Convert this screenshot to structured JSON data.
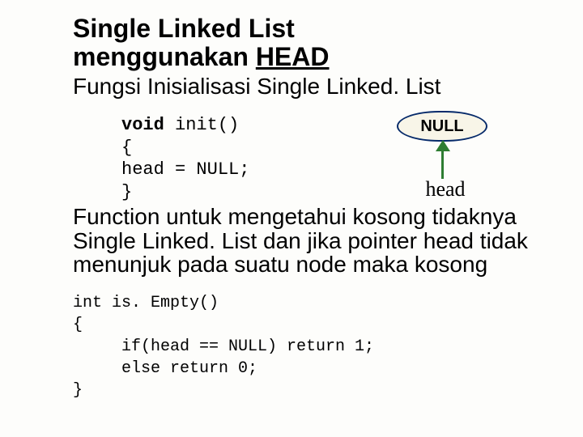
{
  "title": {
    "line1": "Single Linked List",
    "line2_text": "menggunakan ",
    "line2_ul": "HEAD"
  },
  "subtitle": "Fungsi Inisialisasi Single Linked. List",
  "code1": {
    "kw": "void",
    "rest": " init()\n{\nhead = NULL;\n}"
  },
  "diagram": {
    "null_label": "NULL",
    "head_label": "head"
  },
  "paragraph": "Function untuk mengetahui kosong tidaknya Single Linked. List dan jika pointer head tidak menunjuk pada suatu node maka kosong",
  "code2": "int is. Empty()\n{\n     if(head == NULL) return 1;\n     else return 0;\n}"
}
